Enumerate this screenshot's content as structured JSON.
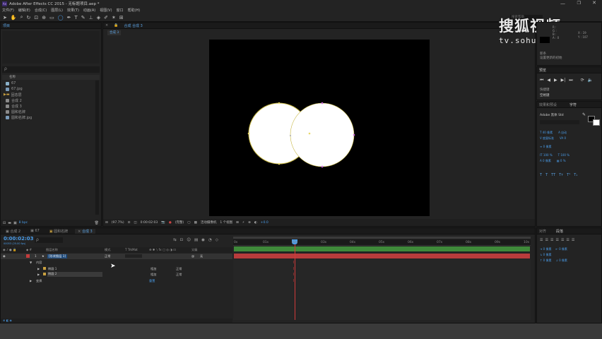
{
  "app": {
    "title": "Adobe After Effects CC 2015 - 无标题项目.aep *",
    "menu": [
      "文件(F)",
      "编辑(E)",
      "合成(C)",
      "图层(L)",
      "效果(T)",
      "动画(A)",
      "视图(V)",
      "窗口",
      "帮助(H)"
    ],
    "search_hint": "搜索帮助"
  },
  "watermark": {
    "line1": "搜狐视频",
    "line2": "tv.sohu.com"
  },
  "project": {
    "tab": "项目",
    "search_placeholder": "ρ",
    "name_header": "名称",
    "items": [
      "67",
      "67.jpg",
      "固态层",
      "合成 2",
      "合成 3",
      "圆和名牌",
      "圆和名牌.jpg"
    ],
    "bpc": "8 bpc"
  },
  "comp_viewer": {
    "tab": "合成 合成 3",
    "breadcrumb": "合成 3",
    "zoom": "(97.7%)",
    "timecode": "0:00:02:03",
    "resolution": "(完整)",
    "camera": "活动摄像机",
    "views": "1 个视图",
    "exposure": "+0.0"
  },
  "info_panel": {
    "r_label": "R :",
    "g_label": "G :",
    "b_label": "B :",
    "a_label": "A : 0",
    "x_val": "X : 19",
    "y_val": "Y : 107",
    "status1": "新条",
    "status2": "设置更新的初始"
  },
  "preview": {
    "title": "预览",
    "shortcut_label": "快捷键",
    "shortcut_value": "空格键"
  },
  "effects": {
    "title": "效果和预设",
    "char_tab": "字符"
  },
  "character": {
    "font": "Adobe 黑体 Std",
    "size": "40 像素",
    "leading": "自动",
    "kerning": "度量标准",
    "tracking": "0",
    "stroke": "0 像素",
    "vscale": "100 %",
    "hscale": "100 %",
    "baseline": "0 像素",
    "tsume": "0 %"
  },
  "paragraph": {
    "tab1": "对齐",
    "tab2": "段落",
    "indent1": "0 像素",
    "indent2": "0 像素",
    "indent3": "0 像素",
    "space1": "0 像素",
    "space2": "0 像素"
  },
  "timeline": {
    "tabs": [
      "合成 2",
      "67",
      "圆和名牌",
      "合成 3"
    ],
    "timecode": "0:00:02:03",
    "fps": "00053 (25.00 fps)",
    "col_name": "图层名称",
    "col_mode": "模式",
    "col_trkmat": "T TrkMat",
    "col_parent": "父级",
    "layer": {
      "num": "1",
      "name": "[形状图层 1]",
      "mode": "正常",
      "parent": "无"
    },
    "contents": "内容",
    "shape1": "椭圆 1",
    "shape2": "椭圆 2",
    "mode_normal": "相加",
    "mode_normal2": "相加",
    "blend1": "正常",
    "blend2": "正常",
    "add_label": "添加:",
    "transform": "变换",
    "reset": "重置",
    "ticks": [
      "0s",
      "01s",
      "02s",
      "03s",
      "04s",
      "05s",
      "06s",
      "07s",
      "08s",
      "09s",
      "10s"
    ]
  },
  "colors": {
    "accent": "#3b8fd6",
    "layer_bar": "#b83c3c",
    "work_area": "#3f8a3a",
    "playhead": "#d23a3a",
    "ellipse_stroke": "#c8b844"
  }
}
